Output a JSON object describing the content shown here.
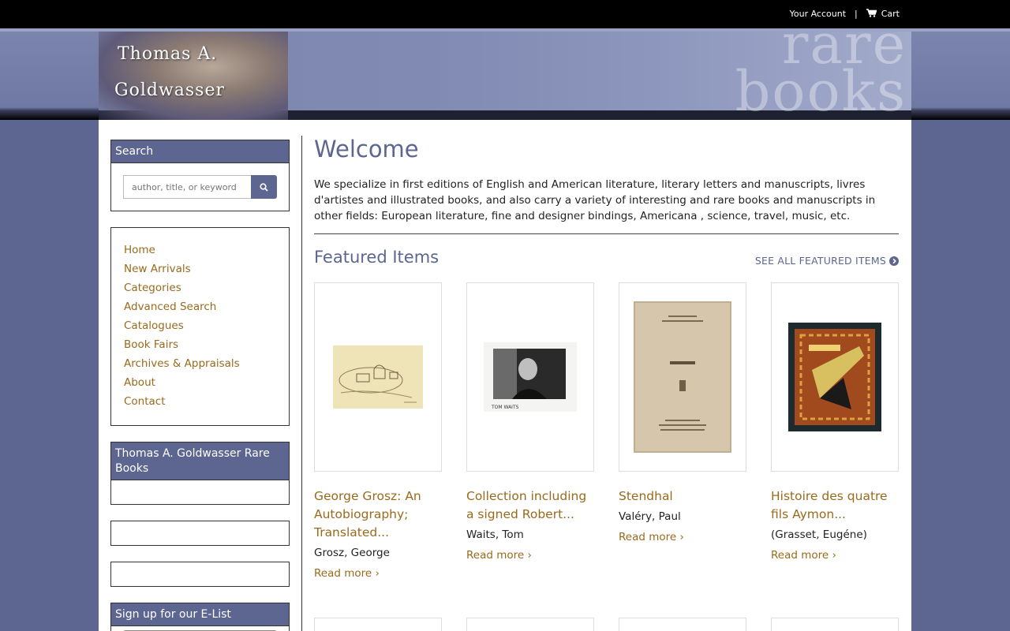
{
  "topbar": {
    "account_label": "Your Account",
    "separator": "|",
    "cart_label": "Cart"
  },
  "header": {
    "logo_line1": "Thomas A.",
    "logo_line2": "Goldwasser",
    "tagline_1": "rare",
    "tagline_2": "books"
  },
  "sidebar": {
    "search": {
      "title": "Search",
      "placeholder": "author, title, or keyword"
    },
    "nav": [
      "Home",
      "New Arrivals",
      "Categories",
      "Advanced Search",
      "Catalogues",
      "Book Fairs",
      "Archives & Appraisals",
      "About",
      "Contact"
    ],
    "company_panel_title": "Thomas A. Goldwasser Rare Books",
    "elist_title": "Sign up for our E-List"
  },
  "main": {
    "title": "Welcome",
    "intro": "We specialize in first editions of English and American literature, literary letters and manuscripts, livres d'artistes and illustrated books, and also carry a variety of interesting and rare books and manuscripts in other fields: European literature, fine and designer bindings, Americana , science, travel, music, etc.",
    "featured_title": "Featured Items",
    "see_all_label": "SEE ALL FEATURED ITEMS",
    "items": [
      {
        "title": "George Grosz: An Autobiography; Translated...",
        "author": "Grosz, George",
        "read_more": "Read more"
      },
      {
        "title": "Collection including a signed Robert...",
        "author": "Waits, Tom",
        "read_more": "Read more"
      },
      {
        "title": "Stendhal",
        "author": "Valéry, Paul",
        "read_more": "Read more"
      },
      {
        "title": "Histoire des quatre fils Aymon...",
        "author": "(Grasset, Eugéne)",
        "read_more": "Read more"
      }
    ]
  },
  "colors": {
    "accent": "#5c6690",
    "link": "#9a6a1c",
    "topbar": "#000000"
  }
}
